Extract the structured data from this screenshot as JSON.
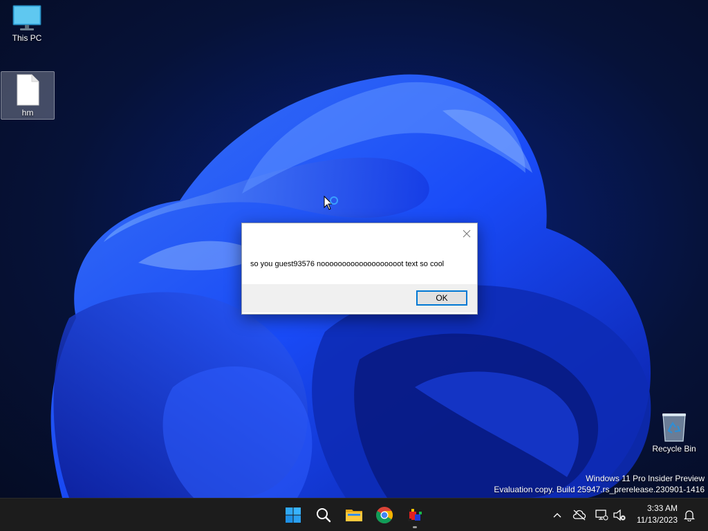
{
  "desktop": {
    "icons": [
      {
        "label": "This PC",
        "icon": "monitor-icon"
      },
      {
        "label": "hm",
        "icon": "text-file-icon"
      },
      {
        "label": "Recycle Bin",
        "icon": "recycle-bin-icon"
      }
    ],
    "watermark": {
      "line1": "Windows 11 Pro Insider Preview",
      "line2": "Evaluation copy. Build 25947.rs_prerelease.230901-1416"
    }
  },
  "dialog": {
    "title": "",
    "message": "so you guest93576 nooooooooooooooooooot text so cool",
    "ok_label": "OK"
  },
  "taskbar": {
    "pinned": [
      {
        "name": "Start",
        "icon": "windows-logo-icon"
      },
      {
        "name": "Search",
        "icon": "search-icon"
      },
      {
        "name": "File Explorer",
        "icon": "folder-icon"
      },
      {
        "name": "Google Chrome",
        "icon": "chrome-icon"
      },
      {
        "name": "App",
        "icon": "app-icon"
      }
    ],
    "tray": {
      "time": "3:33 AM",
      "date": "11/13/2023"
    }
  },
  "colors": {
    "accent": "#0078d4",
    "taskbar_bg": "#1c1c1c",
    "dialog_footer": "#f0f0f0"
  }
}
